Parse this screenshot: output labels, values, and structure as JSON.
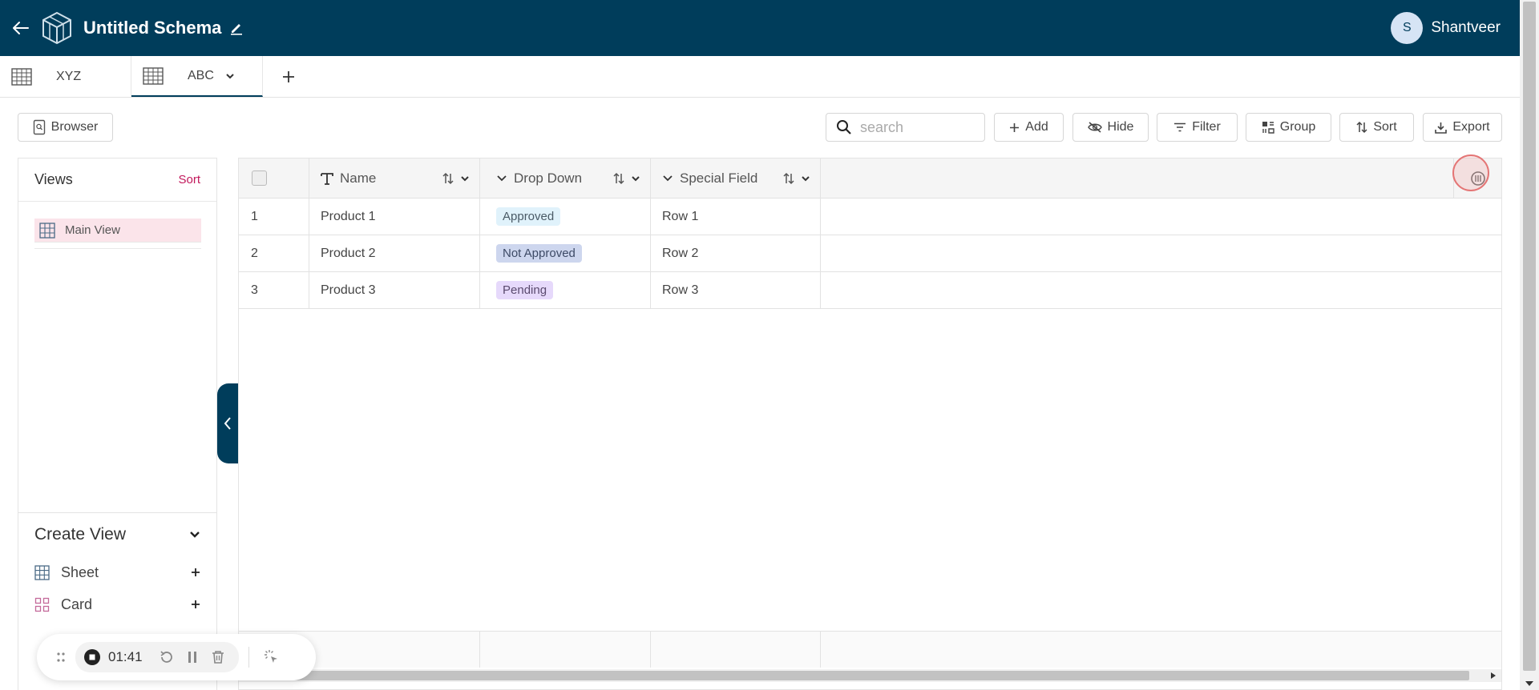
{
  "header": {
    "title": "Untitled Schema",
    "user_initial": "S",
    "user_name": "Shantveer"
  },
  "tabs": [
    {
      "label": "XYZ",
      "active": false
    },
    {
      "label": "ABC",
      "active": true
    }
  ],
  "toolbar": {
    "browser_label": "Browser",
    "search_placeholder": "search",
    "add_label": "Add",
    "hide_label": "Hide",
    "filter_label": "Filter",
    "group_label": "Group",
    "sort_label": "Sort",
    "export_label": "Export"
  },
  "sidebar": {
    "views_title": "Views",
    "views_sort_label": "Sort",
    "views": [
      {
        "label": "Main View"
      }
    ],
    "create_view_title": "Create View",
    "create_items": [
      {
        "label": "Sheet",
        "icon": "grid-icon"
      },
      {
        "label": "Card",
        "icon": "card-grid-icon"
      }
    ]
  },
  "table": {
    "columns": [
      {
        "label": "Name",
        "icon": "text-type-icon"
      },
      {
        "label": "Drop Down",
        "icon": "dropdown-type-icon"
      },
      {
        "label": "Special Field",
        "icon": "dropdown-type-icon"
      }
    ],
    "rows": [
      {
        "num": "1",
        "name": "Product 1",
        "status": "Approved",
        "special": "Row 1"
      },
      {
        "num": "2",
        "name": "Product 2",
        "status": "Not Approved",
        "special": "Row 2"
      },
      {
        "num": "3",
        "name": "Product 3",
        "status": "Pending",
        "special": "Row 3"
      }
    ]
  },
  "recorder": {
    "time": "01:41"
  },
  "colors": {
    "brand": "#003d5b",
    "accent_pink": "#c2185b",
    "approved_bg": "#e0f2fb",
    "not_approved_bg": "#cdd6ee",
    "pending_bg": "#e6d9fb"
  }
}
